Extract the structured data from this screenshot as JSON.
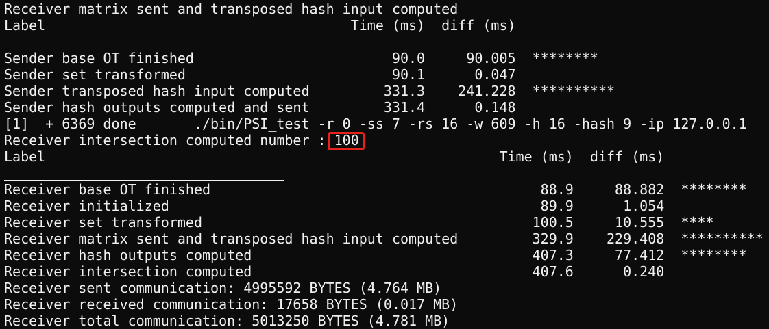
{
  "terminal": {
    "lines": [
      "Receiver matrix sent and transposed hash input computed",
      "Label                                     Time (ms)  diff (ms)",
      "",
      "Sender base OT finished                        90.0     90.005  ********",
      "Sender set transformed                         90.1      0.047",
      "Sender transposed hash input computed         331.3    241.228  **********",
      "Sender hash outputs computed and sent         331.4      0.148",
      "[1]  + 6369 done       ./bin/PSI_test -r 0 -ss 7 -rs 16 -w 609 -h 16 -hash 9 -ip 127.0.0.1",
      "Receiver intersection computed number : 100",
      "Label                                                       Time (ms)  diff (ms)",
      "",
      "Receiver base OT finished                                        88.9     88.882  ********",
      "Receiver initialized                                             89.9      1.054",
      "Receiver set transformed                                        100.5     10.555  ****",
      "Receiver matrix sent and transposed hash input computed         329.9    229.408  **********",
      "Receiver hash outputs computed                                  407.3     77.412  ********",
      "Receiver intersection computed                                  407.6      0.240",
      "Receiver sent communication: 4995592 BYTES (4.764 MB)",
      "Receiver received communication: 17658 BYTES (0.017 MB)",
      "Receiver total communication: 5013250 BYTES (4.781 MB)"
    ],
    "highlighted_value": "100",
    "highlight_color": "#e8231a",
    "text_color": "#f0f0f0",
    "background_color": "#0c0c0c"
  }
}
